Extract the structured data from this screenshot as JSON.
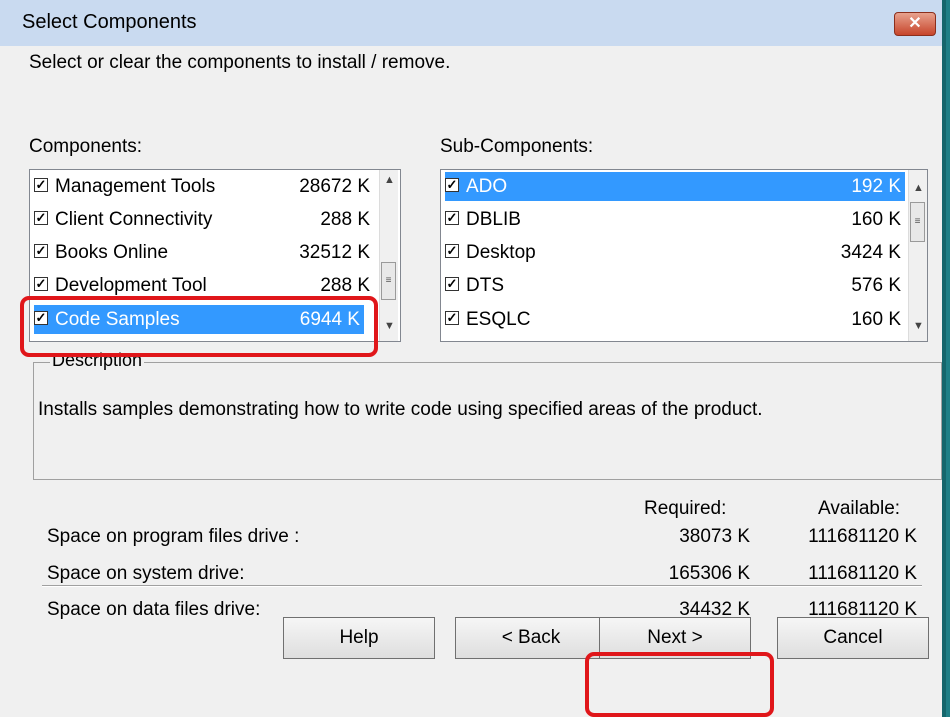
{
  "window": {
    "title": "Select Components",
    "close_label": "✕"
  },
  "instructions": "Select or clear the components to install / remove.",
  "components": {
    "label": "Components:",
    "items": [
      {
        "name": "Management Tools",
        "size": "28672 K",
        "checked": true,
        "selected": false
      },
      {
        "name": "Client Connectivity",
        "size": "288 K",
        "checked": true,
        "selected": false
      },
      {
        "name": "Books Online",
        "size": "32512 K",
        "checked": true,
        "selected": false
      },
      {
        "name": "Development Tool",
        "size": "288 K",
        "checked": true,
        "selected": false
      },
      {
        "name": "Code Samples",
        "size": "6944 K",
        "checked": true,
        "selected": true
      }
    ]
  },
  "subcomponents": {
    "label": "Sub-Components:",
    "items": [
      {
        "name": "ADO",
        "size": "192 K",
        "checked": true,
        "selected": true
      },
      {
        "name": "DBLIB",
        "size": "160 K",
        "checked": true,
        "selected": false
      },
      {
        "name": "Desktop",
        "size": "3424 K",
        "checked": true,
        "selected": false
      },
      {
        "name": "DTS",
        "size": "576 K",
        "checked": true,
        "selected": false
      },
      {
        "name": "ESQLC",
        "size": "160 K",
        "checked": true,
        "selected": false
      }
    ]
  },
  "description": {
    "legend": "Description",
    "text": "Installs samples demonstrating how to write code using specified areas of the product."
  },
  "space": {
    "required_header": "Required:",
    "available_header": "Available:",
    "rows": [
      {
        "label": "Space on program files drive :",
        "required": "38073 K",
        "available": "111681120 K"
      },
      {
        "label": "Space on system drive:",
        "required": "165306 K",
        "available": "111681120 K"
      },
      {
        "label": "Space on data files drive:",
        "required": "34432 K",
        "available": "111681120 K"
      }
    ]
  },
  "buttons": {
    "help": "Help",
    "back": "< Back",
    "next": "Next >",
    "cancel": "Cancel"
  },
  "colors": {
    "selection": "#3399ff",
    "highlight": "#e0161a",
    "titlebar": "#c9daf0"
  }
}
